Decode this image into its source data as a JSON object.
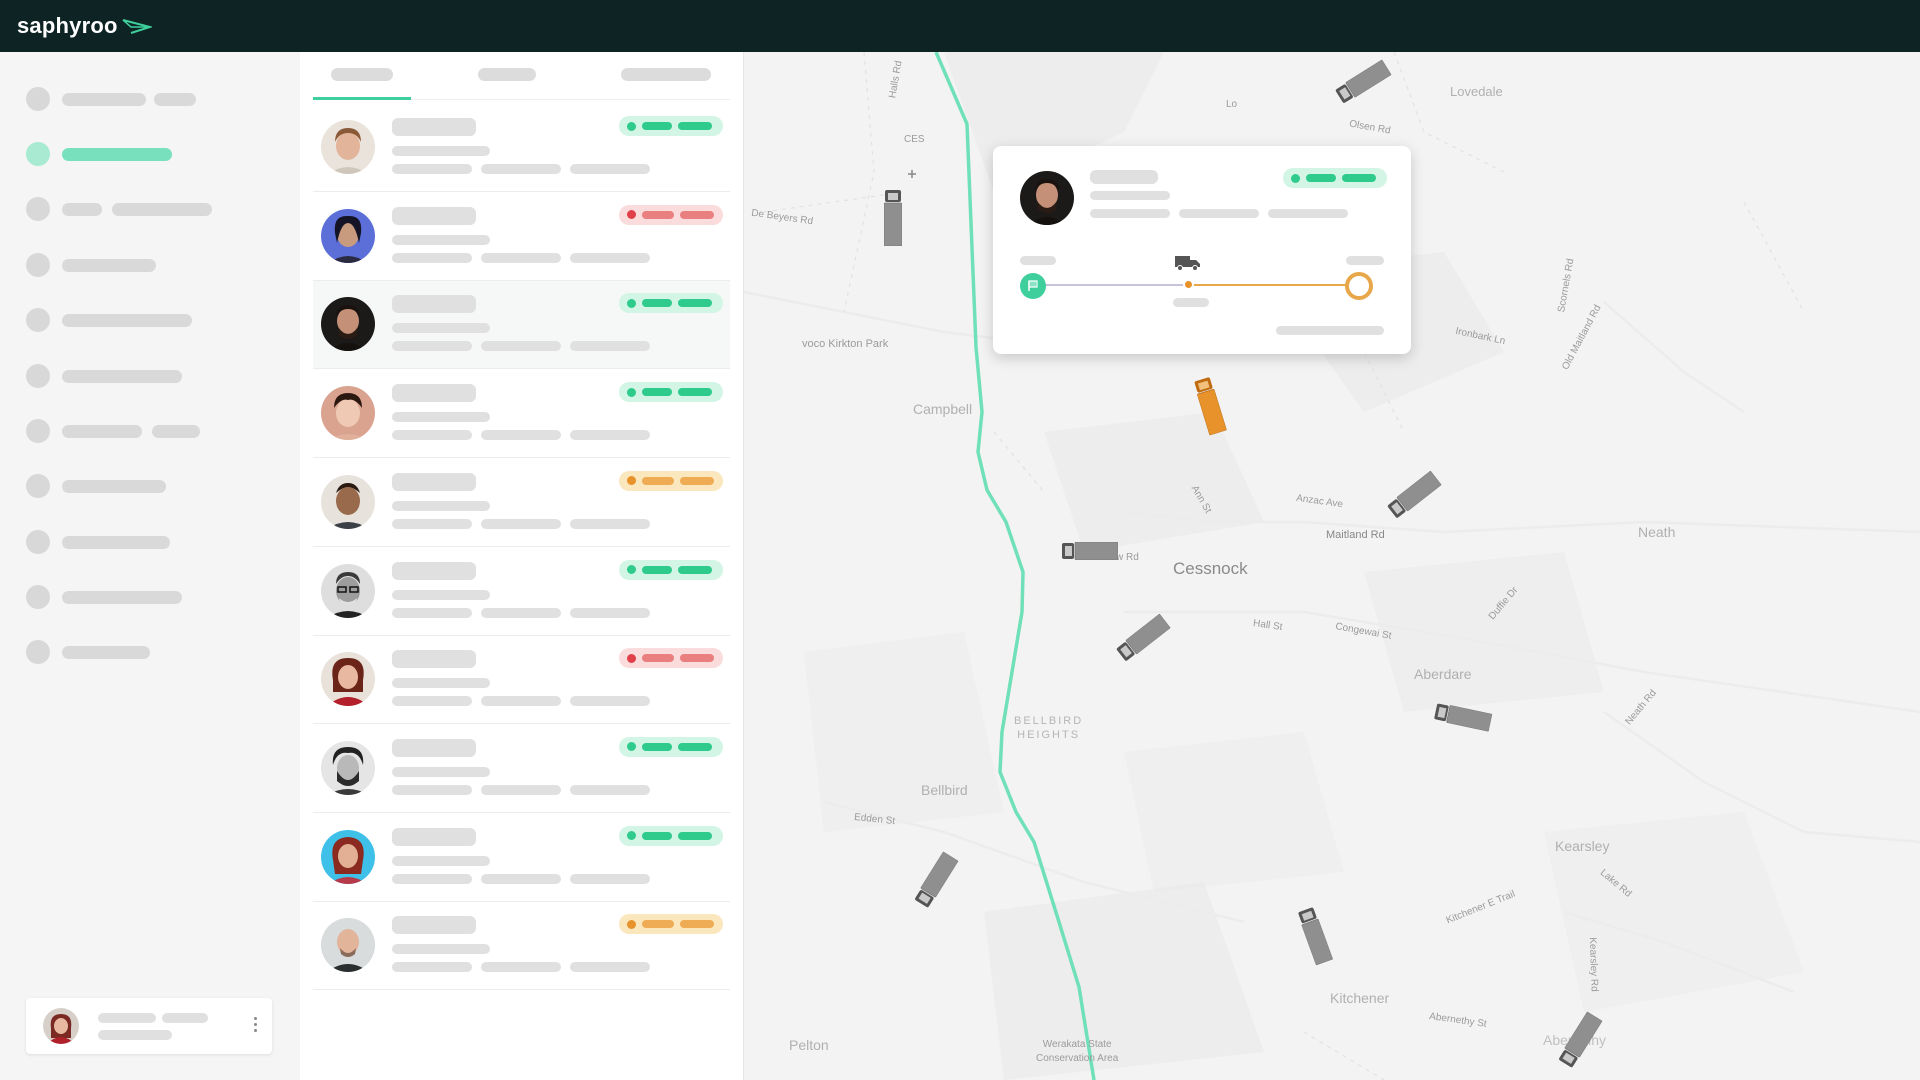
{
  "app": {
    "brand": "saphyroo"
  },
  "map": {
    "labels": [
      "Lovedale",
      "Olsen Rd",
      "De Beyers Rd",
      "voco Kirkton Park",
      "Campbell",
      "Ironbark Ln",
      "Old Maitland Rd",
      "Scornels Rd",
      "Anzac Ave",
      "Maitland Rd",
      "Neath",
      "Cessnock",
      "Hall St",
      "Congewai St",
      "Duffie Dr",
      "Aberdare",
      "Neath Rd",
      "BELLBIRD",
      "HEIGHTS",
      "Bellbird",
      "Edden St",
      "Kearsley",
      "Lake Rd",
      "Kitchener E Trail",
      "Kearsley Rd",
      "Kitchener",
      "Abernethy St",
      "Aberneihy",
      "Pelton",
      "Werakata State",
      "Conservation Area",
      "Ann St",
      "w Rd",
      "Halls Rd",
      "Lo",
      "CES"
    ]
  },
  "colors": {
    "topbar": "#0e2424",
    "accent": "#3ecf9d",
    "route": "#6fe0b8",
    "selected_truck": "#e8922b",
    "status_green": "#2ecb8c",
    "status_red": "#e0404a",
    "status_yellow": "#e8922b"
  },
  "list": {
    "rows": [
      {
        "status": "green"
      },
      {
        "status": "red"
      },
      {
        "status": "green",
        "selected": true
      },
      {
        "status": "green"
      },
      {
        "status": "yellow"
      },
      {
        "status": "green"
      },
      {
        "status": "red"
      },
      {
        "status": "green"
      },
      {
        "status": "green"
      },
      {
        "status": "yellow"
      }
    ]
  },
  "icons": [
    "logo-arrow-icon",
    "menu-dots-icon",
    "start-flag-icon",
    "truck-icon",
    "destination-ring-icon"
  ]
}
